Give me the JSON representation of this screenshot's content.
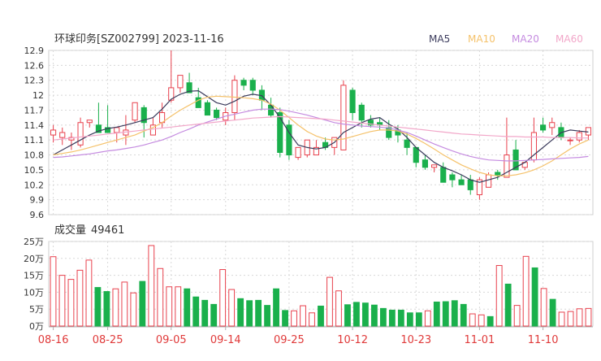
{
  "title": "环球印务[SZ002799] 2023-11-16",
  "legend": [
    {
      "label": "MA5",
      "color": "#3b3b5c"
    },
    {
      "label": "MA10",
      "color": "#f5c26b"
    },
    {
      "label": "MA20",
      "color": "#c58be0"
    },
    {
      "label": "MA60",
      "color": "#f2a7c9"
    }
  ],
  "volume_label": "成交量",
  "volume_value": "49461",
  "colors": {
    "up": "#e8414d",
    "down": "#1ab04c",
    "grid": "#d8d8d8",
    "axis_text": "#333333",
    "date_text": "#e03a3a"
  },
  "chart_data": [
    {
      "type": "candlestick",
      "yticks": [
        "12.9",
        "12.6",
        "12.3",
        "12",
        "11.7",
        "11.4",
        "11.1",
        "10.8",
        "10.5",
        "10.2",
        "9.9",
        "9.6"
      ],
      "ylim": [
        9.6,
        12.9
      ],
      "dates": [
        "08-16",
        "08-25",
        "09-05",
        "09-14",
        "09-25",
        "10-12",
        "10-23",
        "11-01",
        "11-10"
      ],
      "date_index": [
        0,
        6,
        13,
        19,
        26,
        33,
        40,
        47,
        54
      ],
      "open": [
        11.2,
        11.15,
        11.1,
        11.0,
        11.45,
        11.4,
        11.35,
        11.25,
        11.2,
        11.5,
        11.75,
        11.2,
        11.45,
        11.9,
        12.15,
        12.25,
        11.95,
        11.85,
        11.7,
        11.5,
        11.65,
        12.3,
        12.3,
        12.1,
        11.8,
        11.65,
        11.4,
        10.75,
        10.8,
        10.8,
        11.05,
        10.95,
        10.9,
        12.1,
        11.8,
        11.5,
        11.45,
        11.35,
        11.3,
        11.1,
        10.95,
        10.7,
        10.55,
        10.55,
        10.4,
        10.3,
        10.3,
        10.0,
        10.15,
        10.45,
        10.35,
        10.9,
        10.55,
        10.7,
        11.4,
        11.35,
        11.35,
        11.1,
        11.1,
        11.2
      ],
      "high": [
        11.4,
        11.35,
        11.25,
        11.55,
        11.5,
        11.85,
        11.8,
        11.35,
        11.6,
        11.85,
        11.8,
        11.55,
        11.85,
        12.9,
        12.4,
        12.45,
        12.15,
        11.9,
        11.75,
        11.75,
        12.4,
        12.35,
        12.35,
        12.2,
        11.95,
        11.75,
        11.5,
        10.85,
        11.0,
        11.1,
        11.15,
        11.05,
        12.3,
        12.15,
        11.85,
        11.6,
        11.55,
        11.5,
        11.4,
        11.25,
        10.95,
        10.8,
        10.6,
        10.65,
        10.45,
        10.4,
        10.4,
        10.35,
        10.45,
        10.5,
        11.55,
        11.1,
        10.65,
        11.55,
        11.55,
        11.55,
        11.45,
        11.15,
        11.3,
        11.3
      ],
      "low": [
        11.05,
        11.0,
        10.9,
        10.95,
        11.35,
        11.25,
        11.25,
        11.05,
        11.0,
        11.45,
        11.15,
        11.2,
        11.35,
        11.85,
        12.05,
        12.1,
        11.75,
        11.7,
        11.5,
        11.4,
        11.5,
        12.1,
        12.0,
        11.7,
        11.55,
        10.75,
        10.7,
        10.7,
        10.75,
        10.95,
        10.9,
        10.8,
        10.9,
        11.5,
        11.35,
        11.35,
        11.3,
        11.1,
        11.05,
        10.8,
        10.55,
        10.5,
        10.45,
        10.25,
        10.15,
        10.2,
        10.0,
        9.9,
        10.2,
        10.3,
        10.35,
        10.5,
        10.5,
        10.65,
        11.25,
        11.2,
        11.1,
        11.0,
        11.05,
        11.1
      ],
      "close": [
        11.3,
        11.25,
        11.15,
        11.45,
        11.5,
        11.25,
        11.25,
        11.35,
        11.3,
        11.85,
        11.45,
        11.4,
        11.65,
        12.15,
        12.4,
        12.05,
        11.75,
        11.6,
        11.55,
        11.65,
        12.3,
        12.2,
        12.1,
        11.9,
        11.6,
        10.85,
        10.8,
        10.95,
        11.1,
        10.95,
        10.95,
        11.15,
        12.2,
        11.65,
        11.5,
        11.4,
        11.4,
        11.15,
        11.2,
        10.95,
        10.65,
        10.55,
        10.6,
        10.25,
        10.3,
        10.2,
        10.1,
        10.3,
        10.4,
        10.4,
        10.8,
        10.5,
        10.65,
        11.25,
        11.3,
        11.45,
        11.15,
        11.1,
        11.25,
        11.35
      ],
      "ma5": [
        10.8,
        10.9,
        11.0,
        11.1,
        11.2,
        11.28,
        11.33,
        11.36,
        11.4,
        11.45,
        11.5,
        11.55,
        11.72,
        11.92,
        12.02,
        12.08,
        12.09,
        11.97,
        11.85,
        11.8,
        11.88,
        11.98,
        12.02,
        11.99,
        11.8,
        11.55,
        11.25,
        11.0,
        10.95,
        10.92,
        10.95,
        11.05,
        11.25,
        11.35,
        11.45,
        11.52,
        11.55,
        11.42,
        11.32,
        11.15,
        10.95,
        10.8,
        10.65,
        10.55,
        10.48,
        10.4,
        10.3,
        10.25,
        10.3,
        10.35,
        10.45,
        10.55,
        10.65,
        10.8,
        10.95,
        11.1,
        11.25,
        11.3,
        11.28,
        11.26
      ],
      "ma10": [
        10.8,
        10.83,
        10.86,
        10.9,
        10.95,
        11.0,
        11.05,
        11.1,
        11.15,
        11.2,
        11.28,
        11.35,
        11.45,
        11.58,
        11.7,
        11.8,
        11.9,
        11.96,
        11.98,
        11.97,
        11.96,
        11.95,
        11.93,
        11.9,
        11.82,
        11.7,
        11.55,
        11.4,
        11.27,
        11.18,
        11.12,
        11.1,
        11.12,
        11.17,
        11.22,
        11.27,
        11.3,
        11.3,
        11.28,
        11.22,
        11.13,
        11.03,
        10.92,
        10.8,
        10.7,
        10.6,
        10.52,
        10.45,
        10.4,
        10.38,
        10.38,
        10.4,
        10.44,
        10.5,
        10.58,
        10.68,
        10.8,
        10.92,
        11.02,
        11.1
      ],
      "ma20": [
        10.75,
        10.76,
        10.78,
        10.8,
        10.82,
        10.85,
        10.88,
        10.9,
        10.93,
        10.96,
        11.0,
        11.05,
        11.1,
        11.17,
        11.25,
        11.32,
        11.4,
        11.46,
        11.52,
        11.58,
        11.62,
        11.66,
        11.7,
        11.72,
        11.72,
        11.71,
        11.68,
        11.64,
        11.6,
        11.55,
        11.5,
        11.45,
        11.42,
        11.4,
        11.38,
        11.37,
        11.36,
        11.34,
        11.3,
        11.25,
        11.18,
        11.1,
        11.02,
        10.95,
        10.88,
        10.82,
        10.77,
        10.73,
        10.7,
        10.69,
        10.68,
        10.68,
        10.69,
        10.7,
        10.71,
        10.72,
        10.73,
        10.74,
        10.75,
        10.77
      ],
      "ma60": [
        11.1,
        11.12,
        11.14,
        11.16,
        11.18,
        11.2,
        11.22,
        11.24,
        11.26,
        11.28,
        11.3,
        11.32,
        11.34,
        11.36,
        11.38,
        11.4,
        11.42,
        11.44,
        11.46,
        11.48,
        11.5,
        11.52,
        11.54,
        11.55,
        11.56,
        11.57,
        11.56,
        11.55,
        11.54,
        11.53,
        11.52,
        11.5,
        11.48,
        11.46,
        11.44,
        11.42,
        11.4,
        11.38,
        11.36,
        11.34,
        11.32,
        11.3,
        11.28,
        11.26,
        11.24,
        11.22,
        11.21,
        11.2,
        11.19,
        11.18,
        11.17,
        11.17,
        11.16,
        11.16,
        11.16,
        11.15,
        11.15,
        11.15,
        11.14,
        11.14
      ]
    },
    {
      "type": "bar",
      "name": "成交量",
      "yticks": [
        "25万",
        "20万",
        "15万",
        "10万",
        "5万",
        "0万"
      ],
      "ylim": [
        0,
        25
      ],
      "values": [
        20.5,
        15,
        13.8,
        16.5,
        19.5,
        11.4,
        10.2,
        11.0,
        13.0,
        9.8,
        13.2,
        23.8,
        17.0,
        11.6,
        11.6,
        11.0,
        8.6,
        7.6,
        6.4,
        16.7,
        10.8,
        8.1,
        7.5,
        7.6,
        6.1,
        11.0,
        4.6,
        4.5,
        6.0,
        3.9,
        5.9,
        14.4,
        10.4,
        6.3,
        7.0,
        6.8,
        6.2,
        5.2,
        4.7,
        4.7,
        3.9,
        3.9,
        4.5,
        7.1,
        7.2,
        7.5,
        6.4,
        3.6,
        3.3,
        2.8,
        17.9,
        12.4,
        6.1,
        20.6,
        17.2,
        11.1,
        7.9,
        4.1,
        4.3,
        5.1,
        5.2
      ]
    }
  ]
}
